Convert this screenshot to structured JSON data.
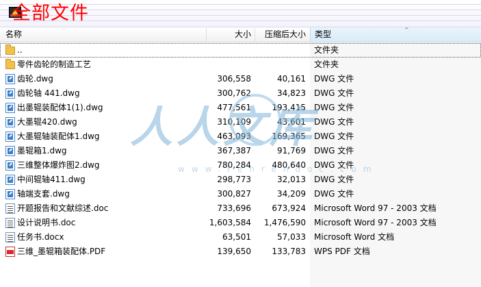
{
  "window": {
    "title": "全部文件"
  },
  "columns": {
    "name": "名称",
    "size": "大小",
    "compressed": "压缩后大小",
    "type": "类型"
  },
  "watermark": {
    "text": "人人文库",
    "sub": "www.renrendoc.com"
  },
  "files": [
    {
      "name": "..",
      "size": "",
      "compressed": "",
      "type": "文件夹",
      "icon": "folder-icon"
    },
    {
      "name": "零件齿轮的制造工艺",
      "size": "",
      "compressed": "",
      "type": "文件夹",
      "icon": "folder-icon"
    },
    {
      "name": "齿轮.dwg",
      "size": "306,558",
      "compressed": "40,161",
      "type": "DWG 文件",
      "icon": "dwg-file-icon"
    },
    {
      "name": "齿轮轴  441.dwg",
      "size": "300,762",
      "compressed": "34,823",
      "type": "DWG 文件",
      "icon": "dwg-file-icon"
    },
    {
      "name": "出墨辊装配体1(1).dwg",
      "size": "477,561",
      "compressed": "193,415",
      "type": "DWG 文件",
      "icon": "dwg-file-icon"
    },
    {
      "name": "大墨辊420.dwg",
      "size": "310,109",
      "compressed": "43,601",
      "type": "DWG 文件",
      "icon": "dwg-file-icon"
    },
    {
      "name": "大墨辊轴装配体1.dwg",
      "size": "463,093",
      "compressed": "169,365",
      "type": "DWG 文件",
      "icon": "dwg-file-icon"
    },
    {
      "name": "墨辊箱1.dwg",
      "size": "367,387",
      "compressed": "91,769",
      "type": "DWG 文件",
      "icon": "dwg-file-icon"
    },
    {
      "name": "三维整体爆炸图2.dwg",
      "size": "780,284",
      "compressed": "480,640",
      "type": "DWG 文件",
      "icon": "dwg-file-icon"
    },
    {
      "name": "中间辊轴411.dwg",
      "size": "298,773",
      "compressed": "32,013",
      "type": "DWG 文件",
      "icon": "dwg-file-icon"
    },
    {
      "name": "轴端支套.dwg",
      "size": "300,827",
      "compressed": "34,209",
      "type": "DWG 文件",
      "icon": "dwg-file-icon"
    },
    {
      "name": "开题报告和文献综述.doc",
      "size": "733,696",
      "compressed": "673,924",
      "type": "Microsoft Word 97 - 2003 文档",
      "icon": "word-doc-icon"
    },
    {
      "name": "设计说明书.doc",
      "size": "1,603,584",
      "compressed": "1,476,590",
      "type": "Microsoft Word 97 - 2003 文档",
      "icon": "word-doc-icon"
    },
    {
      "name": "任务书.docx",
      "size": "63,501",
      "compressed": "57,033",
      "type": "Microsoft Word 文档",
      "icon": "word-doc-icon"
    },
    {
      "name": "三维_墨辊箱装配体.PDF",
      "size": "139,650",
      "compressed": "133,783",
      "type": "WPS PDF 文档",
      "icon": "pdf-file-icon"
    }
  ]
}
